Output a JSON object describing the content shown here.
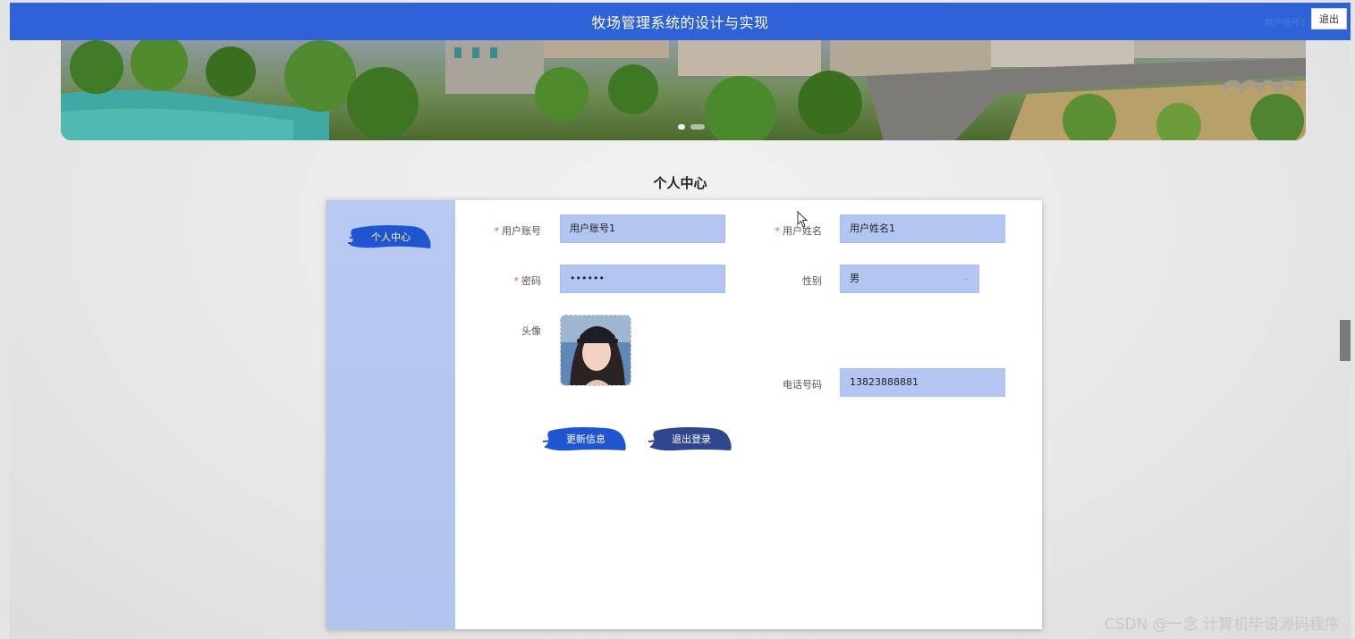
{
  "header": {
    "title": "牧场管理系统的设计与实现",
    "user_label": "用户账号1",
    "logout_label": "退出"
  },
  "banner": {
    "slides": 2,
    "active_slide": 1
  },
  "section": {
    "title": "个人中心"
  },
  "sidebar": {
    "items": [
      {
        "label": "个人中心"
      }
    ]
  },
  "form": {
    "account": {
      "label": "用户账号",
      "required": "*",
      "value": "用户账号1"
    },
    "name": {
      "label": "用户姓名",
      "required": "*",
      "value": "用户姓名1"
    },
    "password": {
      "label": "密码",
      "required": "*",
      "value": "••••••"
    },
    "gender": {
      "label": "性别",
      "value": "男"
    },
    "avatar": {
      "label": "头像"
    },
    "phone": {
      "label": "电话号码",
      "value": "13823888881"
    }
  },
  "buttons": {
    "update": "更新信息",
    "logout": "退出登录"
  },
  "colors": {
    "header_bg": "#2f62d6",
    "sidebar_bg": "#b3c6f1",
    "field_bg": "#b3c6f1",
    "brush_blue": "#1f55d1",
    "brush_navy": "#30468d"
  },
  "watermark": "CSDN @一念 计算机毕设源码程序"
}
